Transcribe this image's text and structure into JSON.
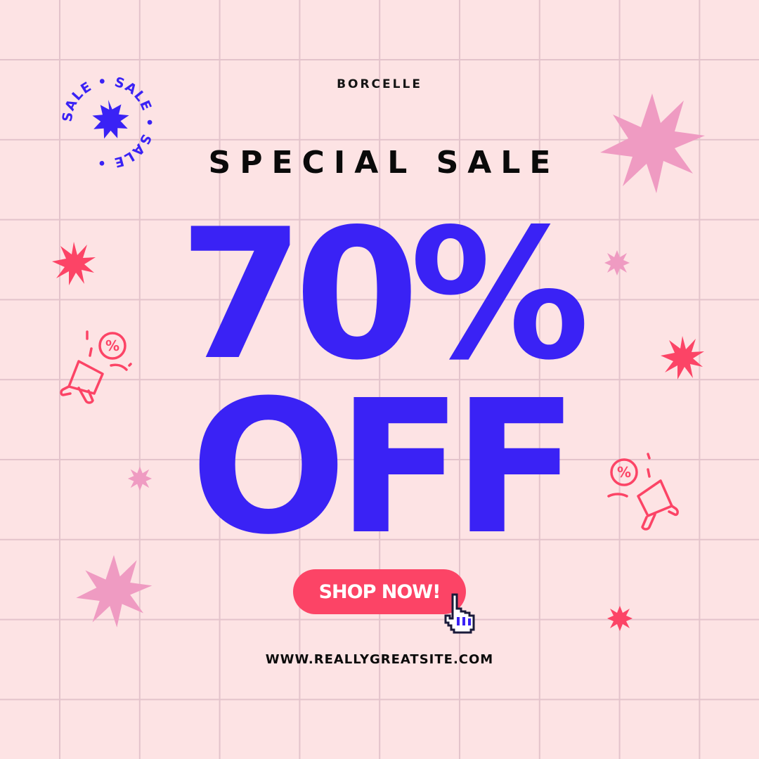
{
  "brand": "BORCELLE",
  "subtitle": "SPECIAL SALE",
  "headline": {
    "line1": "70%",
    "line2": "OFF"
  },
  "cta": {
    "label": "SHOP NOW!"
  },
  "website": "WWW.REALLYGREATSITE.COM",
  "badge": {
    "text": "SALE • SALE • SALE • "
  },
  "colors": {
    "background": "#fde3e4",
    "grid": "#e3c3cb",
    "accent_blue": "#3a22f5",
    "accent_red": "#fc4466",
    "pink_star": "#ef9bc2"
  },
  "icons": [
    "sale-badge-icon",
    "burst-star-icon",
    "megaphone-icon",
    "hand-pointer-icon"
  ]
}
